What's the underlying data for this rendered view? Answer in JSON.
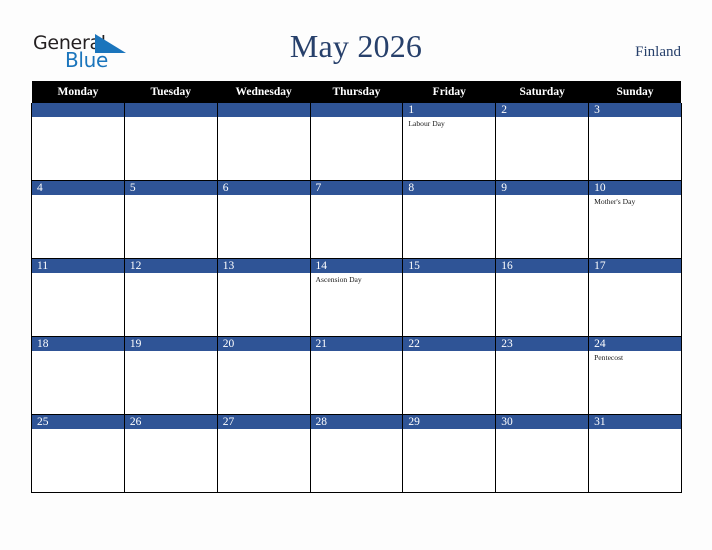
{
  "brand": {
    "name_part1": "General",
    "name_part2": "Blue",
    "triangle_icon": "blue-triangle-icon",
    "color_dark": "#231f20",
    "color_blue": "#1b75bc"
  },
  "header": {
    "title": "May 2026",
    "country": "Finland",
    "title_color": "#27406b"
  },
  "calendar": {
    "accent_color": "#2f5496",
    "header_bg": "#000000",
    "weekdays": [
      "Monday",
      "Tuesday",
      "Wednesday",
      "Thursday",
      "Friday",
      "Saturday",
      "Sunday"
    ],
    "weeks": [
      [
        {
          "day": "",
          "events": []
        },
        {
          "day": "",
          "events": []
        },
        {
          "day": "",
          "events": []
        },
        {
          "day": "",
          "events": []
        },
        {
          "day": "1",
          "events": [
            "Labour Day"
          ]
        },
        {
          "day": "2",
          "events": []
        },
        {
          "day": "3",
          "events": []
        }
      ],
      [
        {
          "day": "4",
          "events": []
        },
        {
          "day": "5",
          "events": []
        },
        {
          "day": "6",
          "events": []
        },
        {
          "day": "7",
          "events": []
        },
        {
          "day": "8",
          "events": []
        },
        {
          "day": "9",
          "events": []
        },
        {
          "day": "10",
          "events": [
            "Mother's Day"
          ]
        }
      ],
      [
        {
          "day": "11",
          "events": []
        },
        {
          "day": "12",
          "events": []
        },
        {
          "day": "13",
          "events": []
        },
        {
          "day": "14",
          "events": [
            "Ascension Day"
          ]
        },
        {
          "day": "15",
          "events": []
        },
        {
          "day": "16",
          "events": []
        },
        {
          "day": "17",
          "events": []
        }
      ],
      [
        {
          "day": "18",
          "events": []
        },
        {
          "day": "19",
          "events": []
        },
        {
          "day": "20",
          "events": []
        },
        {
          "day": "21",
          "events": []
        },
        {
          "day": "22",
          "events": []
        },
        {
          "day": "23",
          "events": []
        },
        {
          "day": "24",
          "events": [
            "Pentecost"
          ]
        }
      ],
      [
        {
          "day": "25",
          "events": []
        },
        {
          "day": "26",
          "events": []
        },
        {
          "day": "27",
          "events": []
        },
        {
          "day": "28",
          "events": []
        },
        {
          "day": "29",
          "events": []
        },
        {
          "day": "30",
          "events": []
        },
        {
          "day": "31",
          "events": []
        }
      ]
    ]
  }
}
